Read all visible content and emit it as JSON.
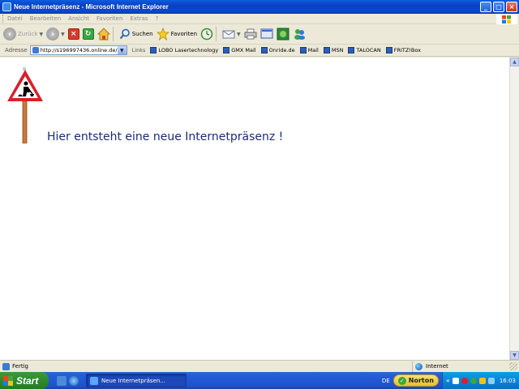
{
  "window": {
    "title": "Neue Internetpräsenz - Microsoft Internet Explorer",
    "minimize": "_",
    "maximize": "□",
    "close": "×"
  },
  "menu": [
    "Datei",
    "Bearbeiten",
    "Ansicht",
    "Favoriten",
    "Extras",
    "?"
  ],
  "toolbar": {
    "back_label": "Zurück",
    "search_label": "Suchen",
    "favorites_label": "Favoriten"
  },
  "address": {
    "label": "Adresse",
    "value": "http://s196997436.online.de/"
  },
  "links": {
    "label": "Links",
    "items": [
      "LOBO Lasertechnology",
      "GMX Mail",
      "Onride.de",
      "Mail",
      "MSN",
      "TALOCAN",
      "FRITZ!Box"
    ]
  },
  "page": {
    "headline": "Hier entsteht eine neue Internetpräsenz !"
  },
  "status": {
    "text": "Fertig",
    "zone": "Internet"
  },
  "taskbar": {
    "start_label": "Start",
    "task_label": "Neue Internetpräsen...",
    "language": "DE",
    "norton_label": "Norton",
    "clock": "16:03"
  },
  "colors": {
    "titlebar": "#0a3fc0",
    "headline": "#1a2a78",
    "start_button": "#2e8a2e",
    "taskbar": "#245edb"
  }
}
